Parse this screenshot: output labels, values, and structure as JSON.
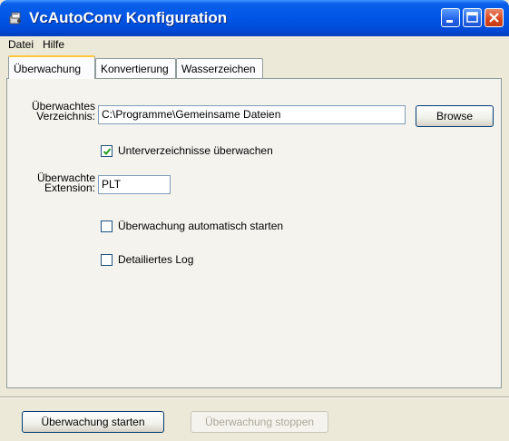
{
  "window": {
    "title": "VcAutoConv Konfiguration",
    "icon": "app-icon",
    "controls": [
      "minimize-icon",
      "maximize-icon",
      "close-icon"
    ]
  },
  "menu": {
    "items": [
      {
        "label": "Datei"
      },
      {
        "label": "Hilfe"
      }
    ]
  },
  "tabs": [
    {
      "label": "Überwachung",
      "active": true
    },
    {
      "label": "Konvertierung",
      "active": false
    },
    {
      "label": "Wasserzeichen",
      "active": false
    }
  ],
  "monitoring": {
    "directory_label_line1": "Überwachtes",
    "directory_label_line2": "Verzeichnis:",
    "directory_value": "C:\\Programme\\Gemeinsame Dateien",
    "browse_label": "Browse",
    "subdirs_label": "Unterverzeichnisse überwachen",
    "subdirs_checked": true,
    "extension_label_line1": "Überwachte",
    "extension_label_line2": "Extension:",
    "extension_value": "PLT",
    "autostart_label": "Überwachung automatisch starten",
    "autostart_checked": false,
    "detailed_log_label": "Detailiertes Log",
    "detailed_log_checked": false
  },
  "footer": {
    "start_label": "Überwachung starten",
    "stop_label": "Überwachung stoppen",
    "stop_enabled": false
  },
  "colors": {
    "titlebar": "#0055E5",
    "dialog_bg": "#ECE9D8",
    "close_button": "#D9451B"
  }
}
